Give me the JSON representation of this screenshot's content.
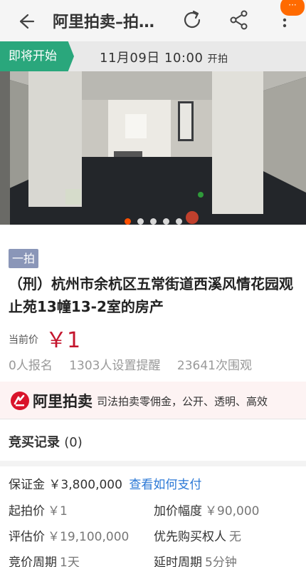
{
  "header": {
    "title": "阿里拍卖–拍…",
    "badge": "···",
    "icons": [
      "back-arrow-icon",
      "refresh-icon",
      "share-icon",
      "more-vertical-icon"
    ]
  },
  "status": {
    "tag": "即将开始",
    "time": "11月09日 10:00",
    "suffix": "开拍",
    "tag_color": "#2aa77c"
  },
  "gallery": {
    "dot_count": 5,
    "active_index": 0
  },
  "item": {
    "round_badge": "一拍",
    "title": "（刑）杭州市余杭区五常街道西溪风情花园观止苑13幢13-2室的房产",
    "price_label": "当前价",
    "price_value": "￥1",
    "price_color": "#c4152d",
    "stats": {
      "signups": "0人报名",
      "reminders": "1303人设置提醒",
      "views": "23641次围观"
    }
  },
  "banner": {
    "brand": "阿里拍卖",
    "slogan": "司法拍卖零佣金，公开、透明、高效"
  },
  "bid_record": {
    "label": "竞买记录",
    "count": "(0)"
  },
  "details": {
    "deposit_label": "保证金",
    "deposit_value": "￥3,800,000",
    "deposit_link": "查看如何支付",
    "start_price_label": "起拍价",
    "start_price_value": "￥1",
    "increment_label": "加价幅度",
    "increment_value": "￥90,000",
    "appraisal_label": "评估价",
    "appraisal_value": "￥19,100,000",
    "priority_label": "优先购买权人",
    "priority_value": "无",
    "period_label": "竞价周期",
    "period_value": "1天",
    "extension_label": "延时周期",
    "extension_value": "5分钟"
  },
  "link_color": "#2b78d6"
}
